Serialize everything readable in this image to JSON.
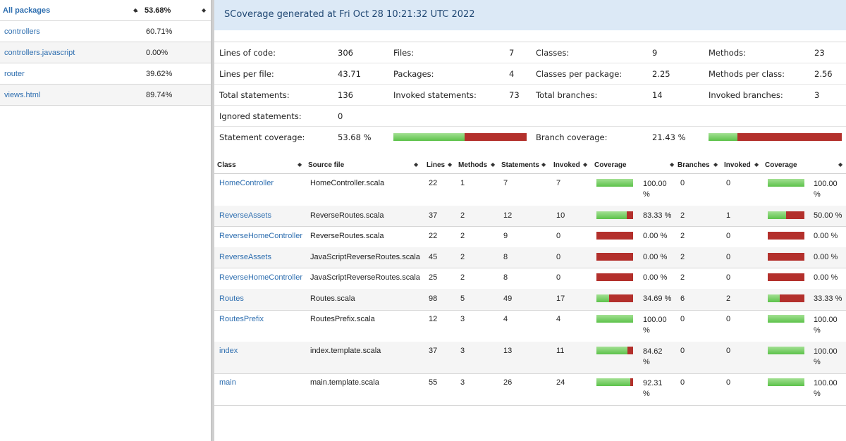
{
  "left": {
    "header": {
      "label": "All packages",
      "pct": "53.68%"
    },
    "packages": [
      {
        "name": "controllers",
        "pct": "60.71%"
      },
      {
        "name": "controllers.javascript",
        "pct": "0.00%"
      },
      {
        "name": "router",
        "pct": "39.62%"
      },
      {
        "name": "views.html",
        "pct": "89.74%"
      }
    ]
  },
  "banner": "SCoverage generated at Fri Oct 28 10:21:32 UTC 2022",
  "stats": {
    "lines_of_code_label": "Lines of code:",
    "lines_of_code": "306",
    "files_label": "Files:",
    "files": "7",
    "classes_label": "Classes:",
    "classes": "9",
    "methods_label": "Methods:",
    "methods": "23",
    "lines_per_file_label": "Lines per file:",
    "lines_per_file": "43.71",
    "packages_label": "Packages:",
    "packages": "4",
    "classes_per_package_label": "Classes per package:",
    "classes_per_package": "2.25",
    "methods_per_class_label": "Methods per class:",
    "methods_per_class": "2.56",
    "total_statements_label": "Total statements:",
    "total_statements": "136",
    "invoked_statements_label": "Invoked statements:",
    "invoked_statements": "73",
    "total_branches_label": "Total branches:",
    "total_branches": "14",
    "invoked_branches_label": "Invoked branches:",
    "invoked_branches": "3",
    "ignored_statements_label": "Ignored statements:",
    "ignored_statements": "0",
    "statement_coverage_label": "Statement coverage:",
    "statement_coverage": "53.68 %",
    "statement_coverage_fraction": 0.5368,
    "branch_coverage_label": "Branch coverage:",
    "branch_coverage": "21.43 %",
    "branch_coverage_fraction": 0.2143
  },
  "table": {
    "headers": [
      "Class",
      "Source file",
      "Lines",
      "Methods",
      "Statements",
      "Invoked",
      "Coverage",
      "Branches",
      "Invoked",
      "Coverage"
    ],
    "rows": [
      {
        "cls": "HomeController",
        "file": "HomeController.scala",
        "lines": "22",
        "methods": "1",
        "statements": "7",
        "invoked": "7",
        "stmt_cov": "100.00 %",
        "stmt_frac": 1.0,
        "branches": "0",
        "b_invoked": "0",
        "branch_cov": "100.00 %",
        "branch_frac": 1.0
      },
      {
        "cls": "ReverseAssets",
        "file": "ReverseRoutes.scala",
        "lines": "37",
        "methods": "2",
        "statements": "12",
        "invoked": "10",
        "stmt_cov": "83.33 %",
        "stmt_frac": 0.8333,
        "branches": "2",
        "b_invoked": "1",
        "branch_cov": "50.00 %",
        "branch_frac": 0.5
      },
      {
        "cls": "ReverseHomeController",
        "file": "ReverseRoutes.scala",
        "lines": "22",
        "methods": "2",
        "statements": "9",
        "invoked": "0",
        "stmt_cov": "0.00 %",
        "stmt_frac": 0.0,
        "branches": "2",
        "b_invoked": "0",
        "branch_cov": "0.00 %",
        "branch_frac": 0.0
      },
      {
        "cls": "ReverseAssets",
        "file": "JavaScriptReverseRoutes.scala",
        "lines": "45",
        "methods": "2",
        "statements": "8",
        "invoked": "0",
        "stmt_cov": "0.00 %",
        "stmt_frac": 0.0,
        "branches": "2",
        "b_invoked": "0",
        "branch_cov": "0.00 %",
        "branch_frac": 0.0
      },
      {
        "cls": "ReverseHomeController",
        "file": "JavaScriptReverseRoutes.scala",
        "lines": "25",
        "methods": "2",
        "statements": "8",
        "invoked": "0",
        "stmt_cov": "0.00 %",
        "stmt_frac": 0.0,
        "branches": "2",
        "b_invoked": "0",
        "branch_cov": "0.00 %",
        "branch_frac": 0.0
      },
      {
        "cls": "Routes",
        "file": "Routes.scala",
        "lines": "98",
        "methods": "5",
        "statements": "49",
        "invoked": "17",
        "stmt_cov": "34.69 %",
        "stmt_frac": 0.3469,
        "branches": "6",
        "b_invoked": "2",
        "branch_cov": "33.33 %",
        "branch_frac": 0.3333
      },
      {
        "cls": "RoutesPrefix",
        "file": "RoutesPrefix.scala",
        "lines": "12",
        "methods": "3",
        "statements": "4",
        "invoked": "4",
        "stmt_cov": "100.00 %",
        "stmt_frac": 1.0,
        "branches": "0",
        "b_invoked": "0",
        "branch_cov": "100.00 %",
        "branch_frac": 1.0
      },
      {
        "cls": "index",
        "file": "index.template.scala",
        "lines": "37",
        "methods": "3",
        "statements": "13",
        "invoked": "11",
        "stmt_cov": "84.62 %",
        "stmt_frac": 0.8462,
        "branches": "0",
        "b_invoked": "0",
        "branch_cov": "100.00 %",
        "branch_frac": 1.0
      },
      {
        "cls": "main",
        "file": "main.template.scala",
        "lines": "55",
        "methods": "3",
        "statements": "26",
        "invoked": "24",
        "stmt_cov": "92.31 %",
        "stmt_frac": 0.9231,
        "branches": "0",
        "b_invoked": "0",
        "branch_cov": "100.00 %",
        "branch_frac": 1.0
      }
    ]
  },
  "colors": {
    "covered": "#5cc24a",
    "uncovered": "#b3302c",
    "banner_bg": "#dce9f6",
    "link": "#2f6fb0"
  }
}
